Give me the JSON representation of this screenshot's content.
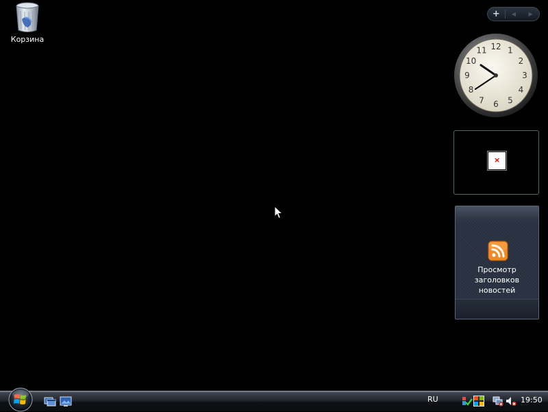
{
  "desktop": {
    "icons": [
      {
        "label": "Корзина",
        "icon": "recycle-bin-icon"
      }
    ]
  },
  "sidebar": {
    "controls": {
      "add": "+",
      "prev": "◀",
      "next": "▶"
    },
    "clock": {
      "numerals": [
        "12",
        "1",
        "2",
        "3",
        "4",
        "5",
        "6",
        "7",
        "8",
        "9",
        "10",
        "11"
      ],
      "time": "19:50",
      "face_color": "#efebdd"
    },
    "blank_gadget": {
      "broken_image_glyph": "×"
    },
    "feed_gadget": {
      "icon": "rss-feed-icon",
      "label_line1": "Просмотр заголовков",
      "label_line2": "новостей",
      "rss_color": "#f08a24"
    }
  },
  "taskbar": {
    "start_icon": "windows-start-orb",
    "quick_launch": [
      "switch-windows-icon",
      "show-desktop-icon"
    ],
    "language": "RU",
    "tray_icons": [
      "security-center-icon",
      "network-disconnected-icon",
      "volume-muted-icon"
    ],
    "clock": "19:50"
  }
}
